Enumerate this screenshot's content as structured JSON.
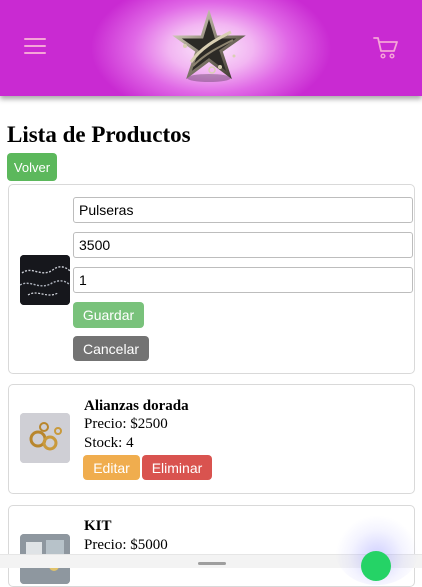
{
  "header": {
    "menu_icon": "hamburger-menu-icon",
    "logo": "star-jewel-logo",
    "cart_icon": "shopping-cart-icon",
    "colors": {
      "header_magenta": "#c92ad2",
      "header_center": "#fbe9fb",
      "icon_pink": "#f6a4d8"
    }
  },
  "page": {
    "title": "Lista de Productos",
    "back_label": "Volver"
  },
  "edit_form": {
    "name_value": "Pulseras",
    "price_value": "3500",
    "stock_value": "1",
    "save_label": "Guardar",
    "cancel_label": "Cancelar"
  },
  "products": [
    {
      "name": "Alianzas dorada",
      "price_text": "Precio: $2500",
      "stock_text": "Stock: 4",
      "edit_label": "Editar",
      "delete_label": "Eliminar"
    },
    {
      "name": "KIT",
      "price_text": "Precio: $5000"
    }
  ],
  "colors": {
    "volver": "#5cb85c",
    "guardar": "#79c27b",
    "cancelar": "#737373",
    "editar": "#f0ad4e",
    "eliminar": "#d9534f",
    "whatsapp": "#25d366"
  }
}
